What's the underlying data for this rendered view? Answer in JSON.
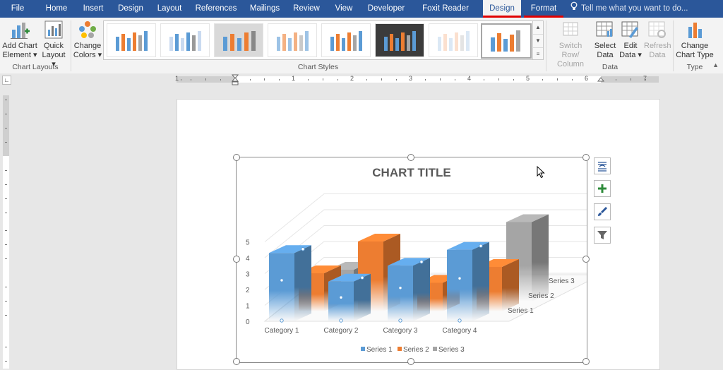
{
  "tabs": [
    {
      "label": "File"
    },
    {
      "label": "Home"
    },
    {
      "label": "Insert"
    },
    {
      "label": "Design"
    },
    {
      "label": "Layout"
    },
    {
      "label": "References"
    },
    {
      "label": "Mailings"
    },
    {
      "label": "Review"
    },
    {
      "label": "View"
    },
    {
      "label": "Developer"
    },
    {
      "label": "Foxit Reader PDF"
    },
    {
      "label": "Design"
    },
    {
      "label": "Format"
    }
  ],
  "tell_me": "Tell me what you want to do...",
  "ribbon": {
    "add_chart_element": [
      "Add Chart",
      "Element"
    ],
    "quick_layout": [
      "Quick",
      "Layout"
    ],
    "change_colors": [
      "Change",
      "Colors"
    ],
    "switch_row_column": [
      "Switch Row/",
      "Column"
    ],
    "select_data": [
      "Select",
      "Data"
    ],
    "edit_data": [
      "Edit",
      "Data"
    ],
    "refresh_data": [
      "Refresh",
      "Data"
    ],
    "change_chart_type": [
      "Change",
      "Chart Type"
    ],
    "groups": {
      "chart_layouts": "Chart Layouts",
      "chart_styles": "Chart Styles",
      "data": "Data",
      "type": "Type"
    }
  },
  "ruler_numbers": [
    "1",
    "1",
    "2",
    "3",
    "4",
    "5",
    "6",
    "7"
  ],
  "colors": {
    "series1": "#5b9bd5",
    "series2": "#ed7d31",
    "series3": "#a5a5a5",
    "accent": "#2b579a",
    "underline": "#e00000"
  },
  "chart_data": {
    "type": "bar",
    "title": "CHART TITLE",
    "categories": [
      "Category 1",
      "Category 2",
      "Category 3",
      "Category 4"
    ],
    "depth_labels": [
      "Series 1",
      "Series 2",
      "Series 3"
    ],
    "yticks": [
      "0",
      "1",
      "2",
      "3",
      "4",
      "5"
    ],
    "ylim": [
      0,
      5
    ],
    "series": [
      {
        "name": "Series 1",
        "values": [
          4.3,
          2.5,
          3.5,
          4.5
        ]
      },
      {
        "name": "Series 2",
        "values": [
          2.4,
          4.4,
          1.8,
          2.8
        ]
      },
      {
        "name": "Series 3",
        "values": [
          2.0,
          2.0,
          3.0,
          5.0
        ]
      }
    ],
    "legend_position": "bottom"
  }
}
